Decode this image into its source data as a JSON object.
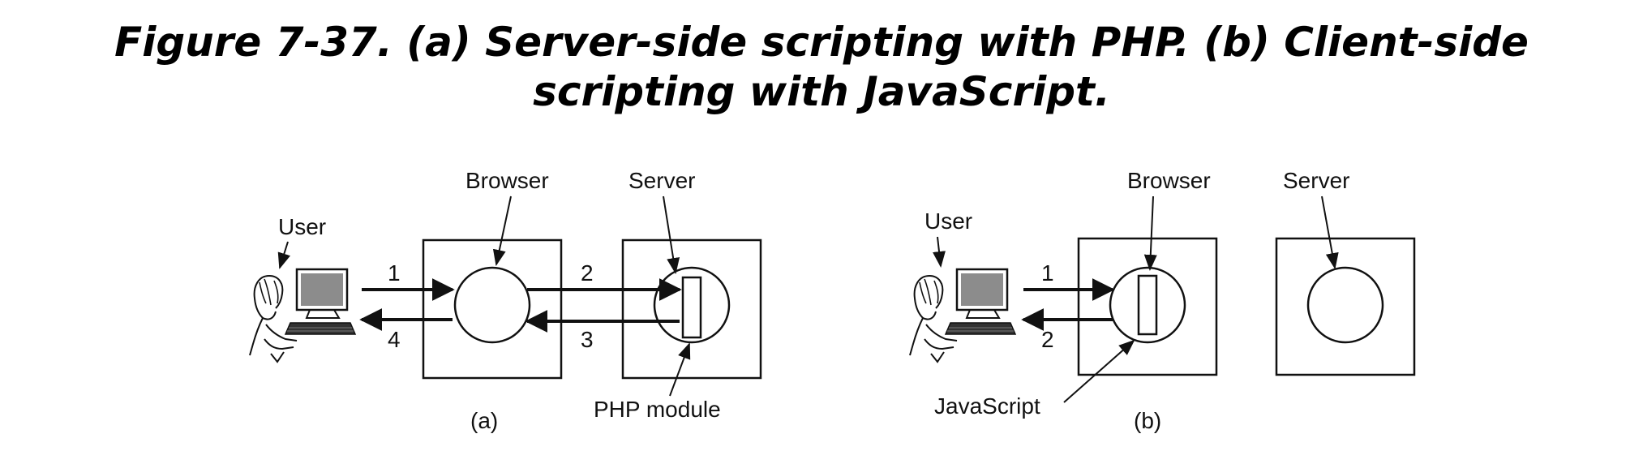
{
  "caption": {
    "line1": "Figure 7-37. (a) Server-side scripting with PHP. (b) Client-side",
    "line2": "scripting with JavaScript."
  },
  "panel_a": {
    "user_label": "User",
    "browser_label": "Browser",
    "server_label": "Server",
    "module_label": "PHP module",
    "panel_label": "(a)",
    "steps": [
      "1",
      "2",
      "3",
      "4"
    ]
  },
  "panel_b": {
    "user_label": "User",
    "browser_label": "Browser",
    "server_label": "Server",
    "script_label": "JavaScript",
    "panel_label": "(b)",
    "steps": [
      "1",
      "2"
    ]
  },
  "colors": {
    "ink": "#111111",
    "screen": "#8c8c8c",
    "background": "#ffffff"
  }
}
